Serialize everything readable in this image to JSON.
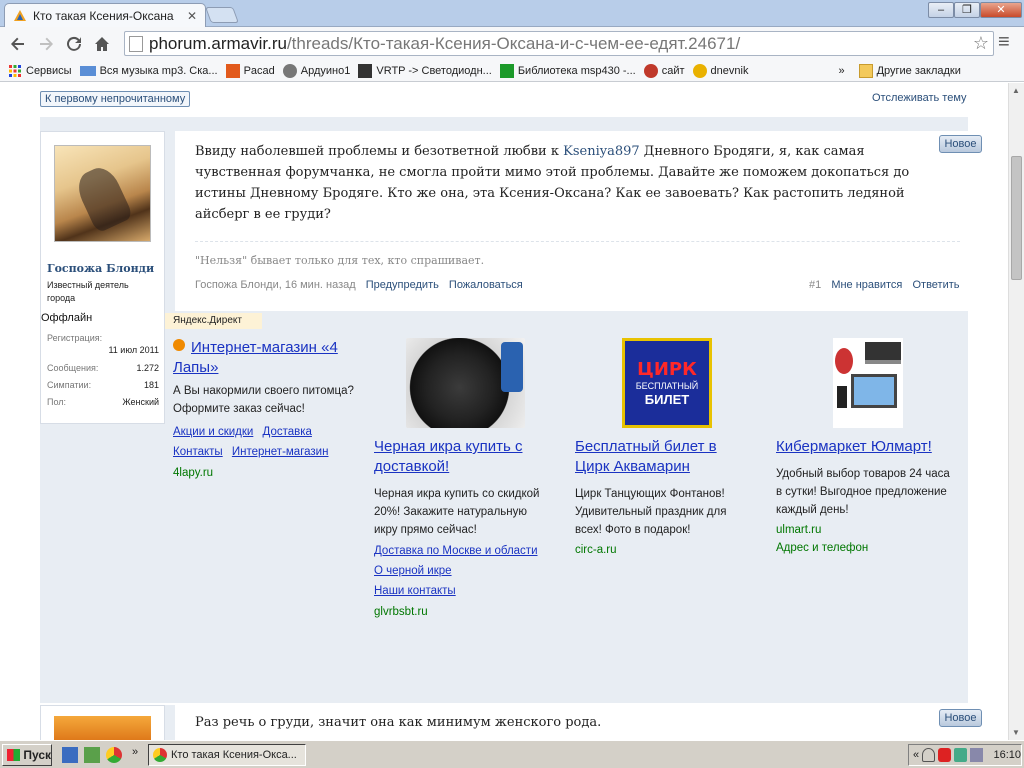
{
  "browser": {
    "tab_title": "Кто такая Ксения-Оксана",
    "url_host": "phorum.armavir.ru",
    "url_path": "/threads/Кто-такая-Ксения-Оксана-и-с-чем-ее-едят.24671/",
    "bookmarks": [
      "Сервисы",
      "Вся музыка mp3. Ска...",
      "Pacad",
      "Ардуино1",
      "VRTP -> Светодиодн...",
      "Библиотека msp430 -...",
      "сайт",
      "dnevnik"
    ],
    "bookmarks_overflow": "»",
    "other_bookmarks": "Другие закладки"
  },
  "thread": {
    "to_unread": "К первому непрочитанному",
    "follow": "Отслеживать тему"
  },
  "post1": {
    "username": "Госпожа Блонди",
    "user_title": "Известный деятель города",
    "status": "Оффлайн",
    "stats": {
      "reg_label": "Регистрация:",
      "reg_value": "11 июл 2011",
      "msgs_label": "Сообщения:",
      "msgs_value": "1.272",
      "likes_label": "Симпатии:",
      "likes_value": "181",
      "gender_label": "Пол:",
      "gender_value": "Женский"
    },
    "text_before": "Ввиду наболевшей проблемы и безответной любви к ",
    "mention": "Kseniya897",
    "text_after": " Дневного Бродяги, я, как самая чувственная форумчанка, не смогла пройти мимо этой проблемы. Давайте же поможем докопаться до истины Дневному Бродяге. Кто же она, эта Ксения-Оксана? Как ее завоевать? Как растопить ледяной айсберг в ее груди?",
    "new_badge": "Новое",
    "signature": "\"Нельзя\" бывает только для тех, кто спрашивает.",
    "meta": "Госпожа Блонди, 16 мин. назад",
    "warn": "Предупредить",
    "report": "Пожаловаться",
    "number": "#1",
    "like": "Мне нравится",
    "reply": "Ответить"
  },
  "ads": {
    "label": "Яндекс.Директ",
    "items": [
      {
        "title": "Интернет-магазин «4 Лапы»",
        "desc": "А Вы накормили своего питомца? Оформите заказ сейчас!",
        "links": [
          "Акции и скидки",
          "Доставка",
          "Контакты",
          "Интернет-магазин"
        ],
        "domain": "4lapy.ru"
      },
      {
        "title": "Черная икра купить с доставкой!",
        "desc": "Черная икра купить со скидкой 20%! Закажите натуральную икру прямо сейчас!",
        "links": [
          "Доставка по Москве и области",
          "О черной икре",
          "Наши контакты"
        ],
        "domain": "glvrbsbt.ru"
      },
      {
        "title": "Бесплатный билет в Цирк Аквамарин",
        "desc": "Цирк Танцующих Фонтанов! Удивительный праздник для всех! Фото в подарок!",
        "domain": "circ-a.ru",
        "image_text": [
          "ЦИРК",
          "БЕСПЛАТНЫЙ",
          "БИЛЕТ"
        ]
      },
      {
        "title": "Кибермаркет Юлмарт!",
        "desc": "Удобный выбор товаров 24 часа в сутки! Выгодное предложение каждый день!",
        "domain": "ulmart.ru",
        "extra": "Адрес и телефон"
      }
    ]
  },
  "post2": {
    "text": "Раз речь о груди, значит она как минимум женского рода.",
    "new_badge": "Новое"
  },
  "taskbar": {
    "start": "Пуск",
    "task": "Кто такая Ксения-Окса...",
    "tray_chevron": "«",
    "clock": "16:10"
  }
}
